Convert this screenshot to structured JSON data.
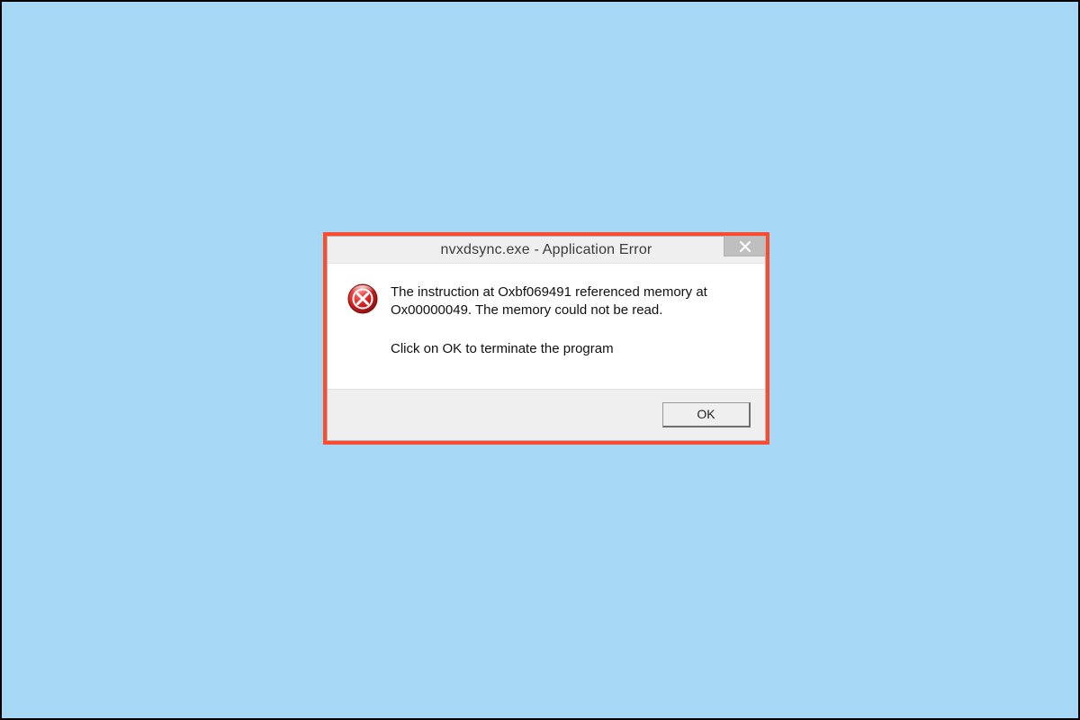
{
  "dialog": {
    "title": "nvxdsync.exe - Application Error",
    "message_primary": "The instruction at Oxbf069491 referenced memory at Ox00000049. The memory could not be read.",
    "message_secondary": "Click on OK to terminate the program",
    "ok_label": "OK"
  },
  "icons": {
    "close": "close-icon",
    "error": "error-icon"
  },
  "colors": {
    "page_bg": "#a6d8f5",
    "highlight_border": "#fb4c2e",
    "error_icon_outer": "#b01717",
    "error_icon_inner": "#d93a3a"
  }
}
